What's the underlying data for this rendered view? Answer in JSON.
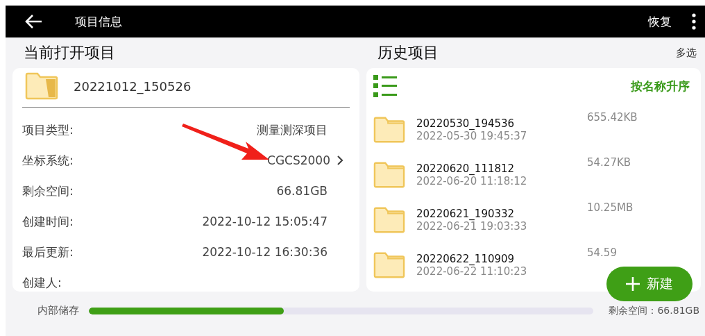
{
  "app_bar": {
    "title": "项目信息",
    "action": "恢复"
  },
  "current_project": {
    "heading": "当前打开项目",
    "name": "20221012_150526",
    "fields": [
      {
        "label": "项目类型:",
        "value": "测量测深项目",
        "link": false
      },
      {
        "label": "坐标系统:",
        "value": "CGCS2000",
        "link": true
      },
      {
        "label": "剩余空间:",
        "value": "66.81GB",
        "link": false
      },
      {
        "label": "创建时间:",
        "value": "2022-10-12 15:05:47",
        "link": false
      },
      {
        "label": "最后更新:",
        "value": "2022-10-12 16:30:36",
        "link": false
      },
      {
        "label": "创建人:",
        "link": false
      }
    ]
  },
  "history": {
    "heading": "历史项目",
    "multi_select": "多选",
    "sort": "按名称升序",
    "items": [
      {
        "name": "20220530_194536",
        "date": "2022-05-30 19:45:37",
        "size": "655.42KB"
      },
      {
        "name": "20220620_111812",
        "date": "2022-06-20 11:18:12",
        "size": "54.27KB"
      },
      {
        "name": "20220621_190332",
        "date": "2022-06-21 19:03:33",
        "size": "10.25MB"
      },
      {
        "name": "20220622_110909",
        "date": "2022-06-22 11:10:23",
        "size": "54.59"
      }
    ],
    "new_button": "新建"
  },
  "storage": {
    "label": "内部储存",
    "level": 0.386,
    "remaining": "剩余空间：66.81GB"
  }
}
